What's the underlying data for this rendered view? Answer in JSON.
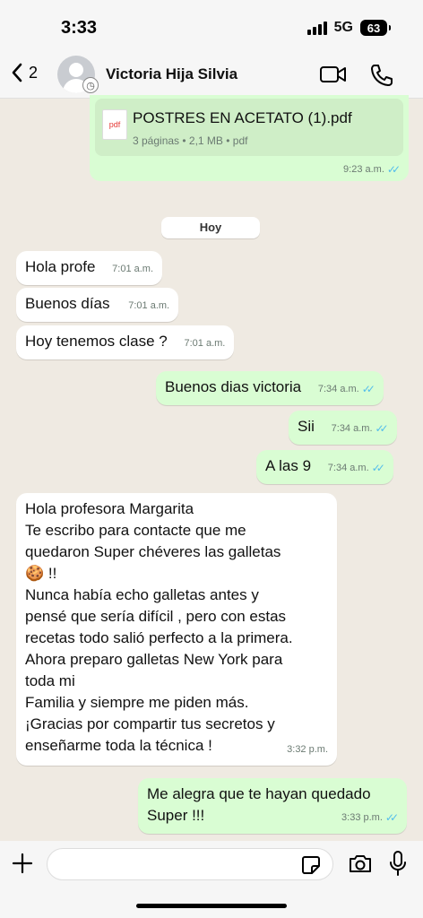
{
  "status_bar": {
    "time": "3:33",
    "network": "5G",
    "battery": "63"
  },
  "header": {
    "back_count": "2",
    "contact_name": "Victoria Hija Silvia"
  },
  "pdf_message": {
    "icon_label": "pdf",
    "title": "POSTRES EN ACETATO (1).pdf",
    "subtitle": "3 páginas • 2,1 MB • pdf",
    "time": "9:23 a.m."
  },
  "day_separator": "Hoy",
  "messages": [
    {
      "text": "Hola profe",
      "time": "7:01 a.m."
    },
    {
      "text": "Buenos días",
      "time": "7:01 a.m."
    },
    {
      "text": "Hoy tenemos clase ?",
      "time": "7:01 a.m."
    },
    {
      "text": "Buenos dias victoria",
      "time": "7:34 a.m."
    },
    {
      "text": "Sii",
      "time": "7:34 a.m."
    },
    {
      "text": "A las 9",
      "time": "7:34 a.m."
    },
    {
      "lines": [
        "Hola profesora Margarita",
        "Te escribo para contacte que me",
        "quedaron Super chéveres las galletas",
        "🍪 !!",
        "Nunca había echo galletas antes y",
        "pensé que sería difícil , pero con estas",
        "recetas todo salió perfecto a la primera.",
        "Ahora preparo galletas New York para",
        "toda mi",
        "Familia y siempre me piden más.",
        "¡Gracias por compartir tus secretos y",
        "enseñarme toda la técnica !"
      ],
      "time": "3:32 p.m."
    },
    {
      "lines": [
        "Me alegra que te hayan quedado",
        "Super !!!"
      ],
      "time": "3:33 p.m."
    }
  ],
  "colors": {
    "incoming": "#ffffff",
    "outgoing": "#d9fdd3",
    "read_ticks": "#53bdeb",
    "background": "#efeae2"
  }
}
